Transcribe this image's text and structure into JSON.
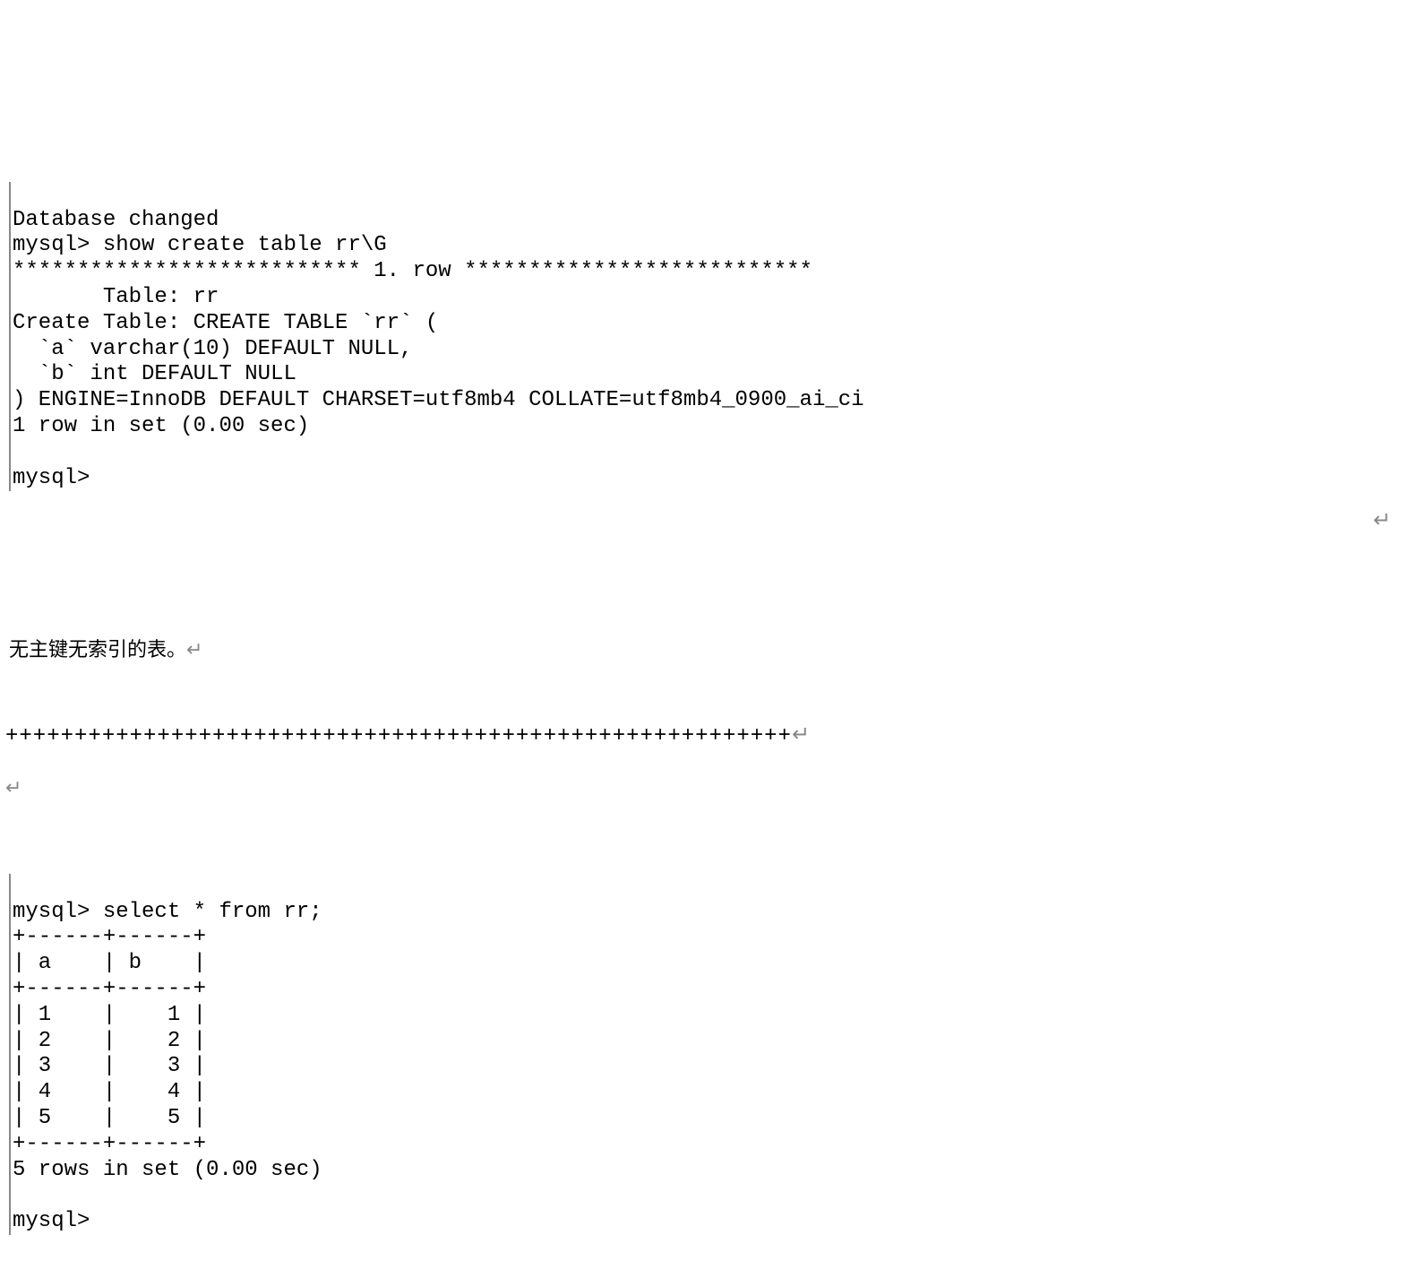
{
  "block1": {
    "line1": "Database changed",
    "line2": "mysql> show create table rr\\G",
    "line3": "*************************** 1. row ***************************",
    "line4": "       Table: rr",
    "line5": "Create Table: CREATE TABLE `rr` (",
    "line6": "  `a` varchar(10) DEFAULT NULL,",
    "line7": "  `b` int DEFAULT NULL",
    "line8": ") ENGINE=InnoDB DEFAULT CHARSET=utf8mb4 COLLATE=utf8mb4_0900_ai_ci",
    "line9": "1 row in set (0.00 sec)",
    "line10": "",
    "line11": "mysql>"
  },
  "comment": {
    "text": "无主键无索引的表。",
    "return_symbol": "↵"
  },
  "separator": {
    "plus_line": "+++++++++++++++++++++++++++++++++++++++++++++++++++++++++",
    "return_symbol": "↵"
  },
  "empty_line_symbol": "↵",
  "block2": {
    "line1": "mysql> select * from rr;",
    "line2": "+------+------+",
    "line3": "| a    | b    |",
    "line4": "+------+------+",
    "line5": "| 1    |    1 |",
    "line6": "| 2    |    2 |",
    "line7": "| 3    |    3 |",
    "line8": "| 4    |    4 |",
    "line9": "| 5    |    5 |",
    "line10": "+------+------+",
    "line11": "5 rows in set (0.00 sec)",
    "line12": "",
    "line13": "mysql>"
  },
  "chart_data": {
    "type": "table",
    "title": "select * from rr",
    "columns": [
      "a",
      "b"
    ],
    "rows": [
      [
        "1",
        1
      ],
      [
        "2",
        2
      ],
      [
        "3",
        3
      ],
      [
        "4",
        4
      ],
      [
        "5",
        5
      ]
    ],
    "row_count": 5,
    "exec_time_sec": 0.0,
    "table_definition": {
      "table_name": "rr",
      "columns": [
        {
          "name": "a",
          "type": "varchar(10)",
          "default": "NULL"
        },
        {
          "name": "b",
          "type": "int",
          "default": "NULL"
        }
      ],
      "engine": "InnoDB",
      "charset": "utf8mb4",
      "collate": "utf8mb4_0900_ai_ci"
    }
  }
}
